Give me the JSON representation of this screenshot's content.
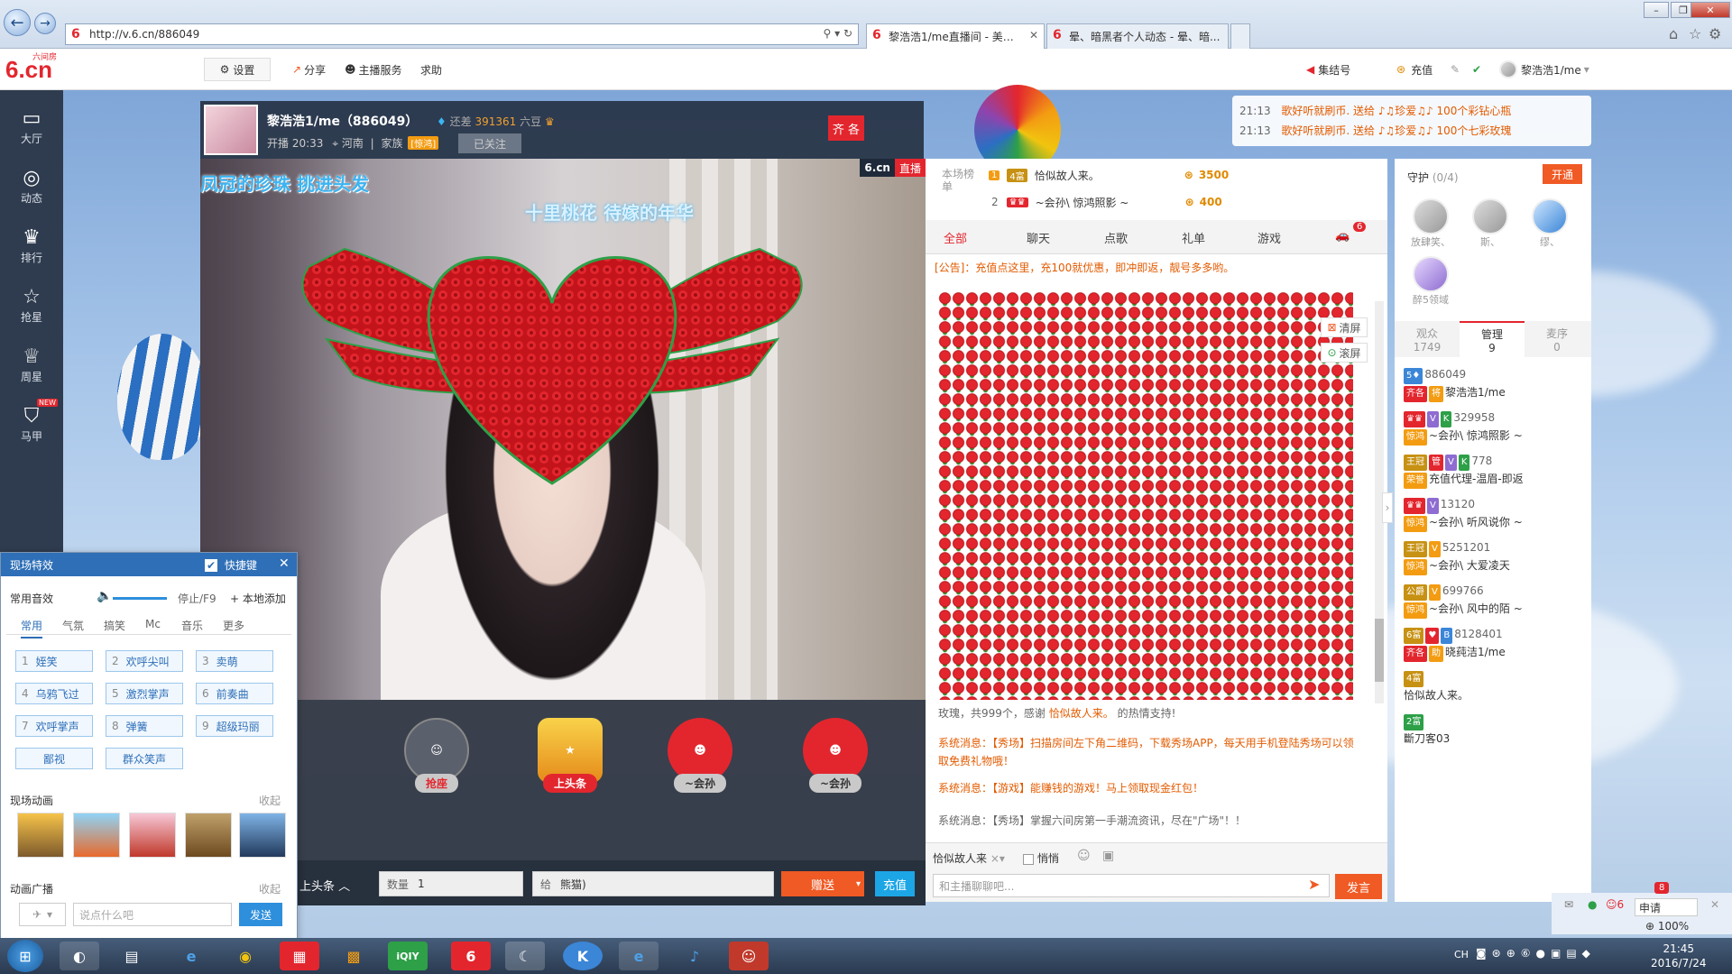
{
  "browser": {
    "url": "http://v.6.cn/886049",
    "tabs": [
      {
        "title": "黎浩浩1/me直播间 - 美女..."
      },
      {
        "title": "晕、暗黑者个人动态 - 晕、暗..."
      }
    ]
  },
  "site": {
    "logo_main": "6.cn",
    "logo_small": "六间房",
    "settings": "设置",
    "share": "分享",
    "anchor_service": "主播服务",
    "help": "求助",
    "collect": "集结号",
    "recharge": "充值",
    "user_name": "黎浩浩1/me"
  },
  "leftnav": [
    {
      "label": "大厅",
      "icon": "tv-icon"
    },
    {
      "label": "动态",
      "icon": "compass-icon"
    },
    {
      "label": "排行",
      "icon": "crown-icon"
    },
    {
      "label": "抢星",
      "icon": "star-icon"
    },
    {
      "label": "周星",
      "icon": "cup-icon"
    },
    {
      "label": "马甲",
      "icon": "vest-icon",
      "new": "NEW"
    }
  ],
  "anchor": {
    "name": "黎浩浩1/me（886049）",
    "gap_label": "还差",
    "gap_value": "391361",
    "gap_unit": "六豆",
    "start_time": "开播 20:33",
    "location": "河南",
    "family_label": "家族",
    "family_badge": "[惊鸿]",
    "follow_state": "已关注",
    "flag": "齐 各"
  },
  "video": {
    "lyric1": "凤冠的珍珠  挑进头发",
    "lyric2": "十里桃花  待嫁的年华",
    "watermark": "6.cn",
    "live_tag": "直播"
  },
  "stage": {
    "seats": [
      {
        "label": "座"
      },
      {
        "label": "抢座"
      },
      {
        "label": "上头条"
      },
      {
        "label": "~会孙"
      },
      {
        "label": "~会孙"
      }
    ],
    "headline_tab": "上头条",
    "qty_label": "数量",
    "qty_value": "1",
    "target_label": "给",
    "target_value": "熊猫)",
    "send_gift": "赠送",
    "recharge": "充值"
  },
  "effects": {
    "title": "现场特效",
    "hotkey": "快捷键",
    "common_sound": "常用音效",
    "stop": "停止/F9",
    "add_local": "本地添加",
    "tabs": [
      "常用",
      "气氛",
      "搞笑",
      "Mc",
      "音乐",
      "更多"
    ],
    "sounds": [
      {
        "no": "1",
        "label": "姪笑"
      },
      {
        "no": "2",
        "label": "欢呼尖叫"
      },
      {
        "no": "3",
        "label": "卖萌"
      },
      {
        "no": "4",
        "label": "乌鸦飞过"
      },
      {
        "no": "5",
        "label": "激烈掌声"
      },
      {
        "no": "6",
        "label": "前奏曲"
      },
      {
        "no": "7",
        "label": "欢呼掌声"
      },
      {
        "no": "8",
        "label": "弹簧"
      },
      {
        "no": "9",
        "label": "超级玛丽"
      },
      {
        "no": "",
        "label": "鄙视"
      },
      {
        "no": "",
        "label": "群众笑声"
      }
    ],
    "anim_title": "现场动画",
    "collapse": "收起",
    "broadcast_title": "动画广播",
    "broadcast_placeholder": "说点什么吧",
    "send": "发送"
  },
  "rank": {
    "label": "本场榜单",
    "rows": [
      {
        "no": "1",
        "name": "恰似故人来。",
        "coins": "3500"
      },
      {
        "no": "2",
        "name": "~会孙\\ 惊鸿照影 ~",
        "coins": "400"
      }
    ]
  },
  "chat": {
    "tabs": [
      "全部",
      "聊天",
      "点歌",
      "礼单",
      "游戏"
    ],
    "car_count": "6",
    "notice": "[公告]：充值点这里，充100就优惠，即冲即返，靓号多多哟。",
    "clear": "清屏",
    "scroll": "滚屏",
    "rose_thanks_prefix": "玫瑰，共999个，感谢",
    "rose_thanks_name": "恰似故人来。",
    "rose_thanks_suffix": "的热情支持!",
    "sys1": "系统消息：【秀场】扫描房间左下角二维码，下载秀场APP，每天用手机登陆秀场可以领取免费礼物哦！",
    "sys2": "系统消息：【游戏】能赚钱的游戏！马上领取现金红包！",
    "sys3": "系统消息：【秀场】掌握六间房第一手潮流资讯，尽在\"广场\"！！",
    "to_label": "恰似故人来",
    "whisper": "悄悄",
    "input_placeholder": "和主播聊聊吧...",
    "send": "发言"
  },
  "giftfeed": [
    {
      "time": "21:13",
      "text": "歌好听就刷币. 送给 ♪♫珍爱♫♪ 100个彩钻心瓶"
    },
    {
      "time": "21:13",
      "text": "歌好听就刷币. 送给 ♪♫珍爱♫♪ 100个七彩玫瑰"
    }
  ],
  "guard": {
    "title": "守护",
    "count": "(0/4)",
    "open": "开通",
    "members": [
      {
        "name": "放肆笑、"
      },
      {
        "name": "斯、"
      },
      {
        "name": "缪、"
      },
      {
        "name": "醉5领域"
      }
    ]
  },
  "roomtabs": [
    {
      "label": "观众",
      "count": "1749"
    },
    {
      "label": "管理",
      "count": "9"
    },
    {
      "label": "麦序",
      "count": "0"
    }
  ],
  "users": [
    {
      "id": "886049",
      "name": "黎浩浩1/me"
    },
    {
      "id": "329958",
      "name": "~会孙\\ 惊鸿照影 ~"
    },
    {
      "id": "778",
      "name": "充值代理-温眉-即返"
    },
    {
      "id": "13120",
      "name": "~会孙\\ 听风说你 ~"
    },
    {
      "id": "5251201",
      "name": "~会孙\\ 大爱凌天"
    },
    {
      "id": "699766",
      "name": "~会孙\\ 风中的陌 ~"
    },
    {
      "id": "8128401",
      "name": "晓莼洁1/me"
    },
    {
      "id": "",
      "name": "恰似故人来。"
    },
    {
      "id": "",
      "name": "斷刀客03"
    }
  ],
  "status": {
    "apply": "申请",
    "apply_count": "8",
    "people_count": "6",
    "zoom": "100%"
  },
  "taskbar": {
    "time": "21:45",
    "date": "2016/7/24",
    "lang": "CH"
  },
  "colors": {
    "brand_red": "#e3262e",
    "orange": "#f05a24",
    "blue": "#2e6fb7"
  }
}
